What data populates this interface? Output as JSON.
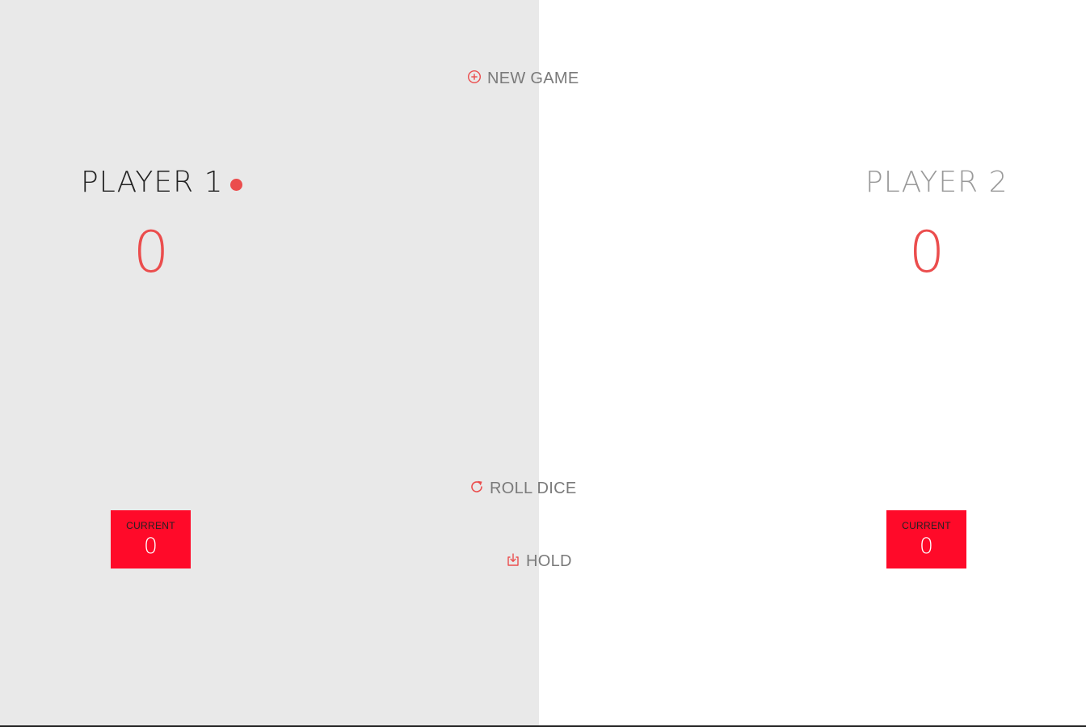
{
  "players": [
    {
      "name": "PLAYER 1",
      "score": "0",
      "current_label": "CURRENT",
      "current": "0",
      "active": true
    },
    {
      "name": "PLAYER 2",
      "score": "0",
      "current_label": "CURRENT",
      "current": "0",
      "active": false
    }
  ],
  "controls": {
    "new_game": "NEW GAME",
    "roll_dice": "ROLL DICE",
    "hold": "HOLD"
  },
  "icons": {
    "new_game": "add-circle-icon",
    "roll_dice": "refresh-icon",
    "hold": "download-icon",
    "active_player": "active-dot-icon"
  },
  "colors": {
    "accent": "#eb4d4d",
    "current_box": "#ff0a29",
    "active_panel": "#e9e9e9",
    "inactive_panel": "#ffffff"
  }
}
